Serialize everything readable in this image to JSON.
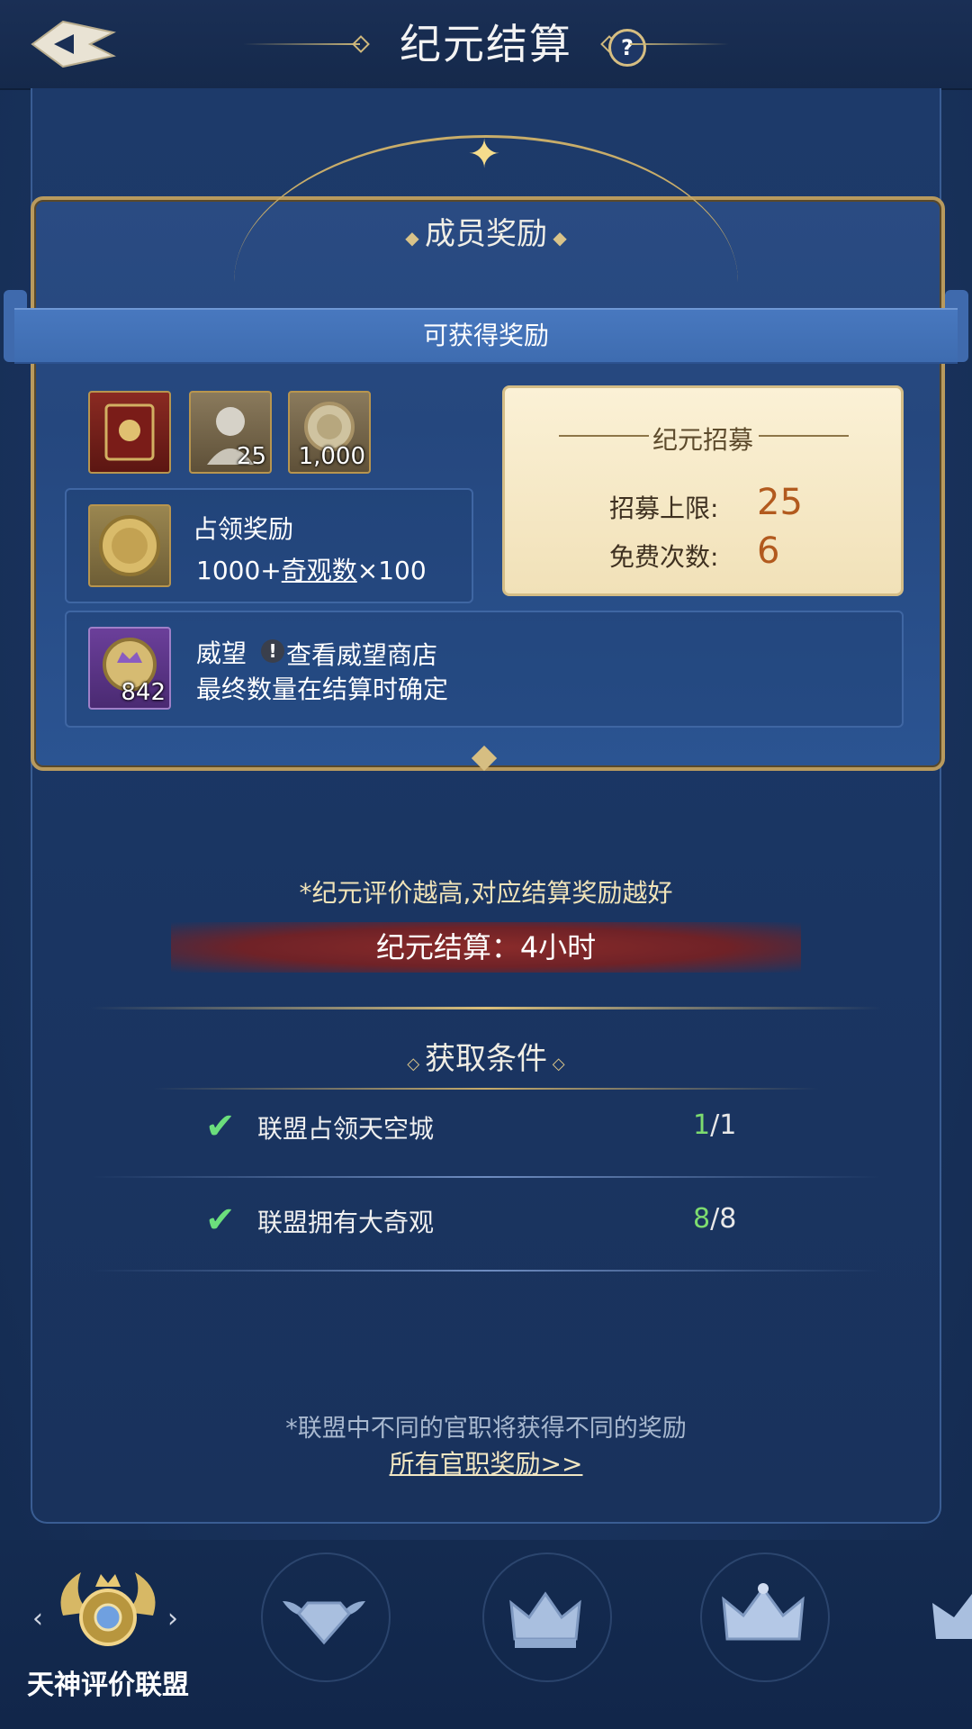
{
  "header": {
    "title": "纪元结算",
    "help_glyph": "?"
  },
  "card": {
    "title": "成员奖励",
    "ribbon": "可获得奖励",
    "items": [
      {
        "name": "book",
        "count": ""
      },
      {
        "name": "bust",
        "count": "25"
      },
      {
        "name": "coin",
        "count": "1,000"
      }
    ],
    "occupation": {
      "title": "占领奖励",
      "prefix": "1000+",
      "link": "奇观数",
      "suffix": "×100"
    },
    "prestige": {
      "title": "威望",
      "count": "842",
      "link": "查看威望商店",
      "note": "最终数量在结算时确定"
    },
    "recruit": {
      "title": "纪元招募",
      "limit_label": "招募上限:",
      "limit_value": "25",
      "free_label": "免费次数:",
      "free_value": "6"
    }
  },
  "hint": "*纪元评价越高,对应结算奖励越好",
  "timer": "纪元结算：4小时",
  "conditions": {
    "title": "获取条件",
    "rows": [
      {
        "label": "联盟占领天空城",
        "done": "1",
        "total": "/1"
      },
      {
        "label": "联盟拥有大奇观",
        "done": "8",
        "total": "/8"
      }
    ]
  },
  "footer": {
    "note": "*联盟中不同的官职将获得不同的奖励",
    "link": "所有官职奖励>>"
  },
  "tabs": {
    "active_label": "天神评价联盟",
    "left_arrow": "‹",
    "right_arrow": "›"
  },
  "colors": {
    "accent_gold": "#d6be82",
    "progress_done": "#7ddc6f",
    "recruit_value": "#b25a1e"
  }
}
